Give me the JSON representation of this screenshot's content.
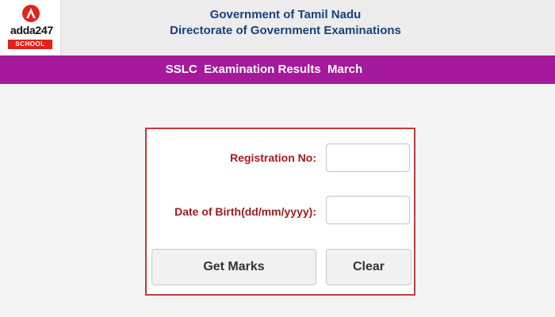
{
  "logo": {
    "brand": "adda247",
    "tag": "SCHOOL",
    "colors": {
      "red": "#e2231a",
      "text": "#111111"
    }
  },
  "header": {
    "line1": "Government of Tamil Nadu",
    "line2": "Directorate of Government Examinations",
    "color": "#1b3f7a"
  },
  "banner": {
    "title": "SSLC  Examination Results  March",
    "background": "#a41a9a"
  },
  "form": {
    "registration_label": "Registration No:",
    "registration_value": "",
    "dob_label": "Date of Birth(dd/mm/yyyy):",
    "dob_value": "",
    "get_marks_label": "Get Marks",
    "clear_label": "Clear",
    "border_color": "#c03a3a",
    "label_color": "#9e1b1b"
  }
}
